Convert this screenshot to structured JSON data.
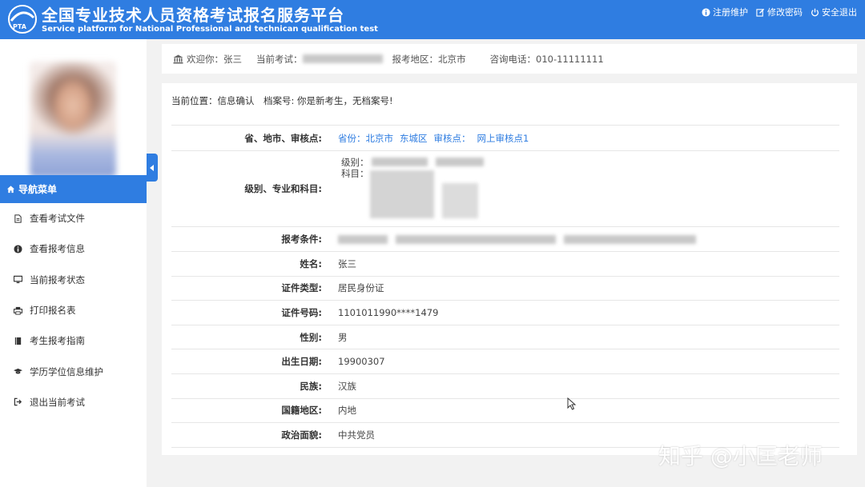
{
  "header": {
    "title_cn": "全国专业技术人员资格考试报名服务平台",
    "title_en": "Service platform for National Professional and technican qualification test",
    "links": [
      "注册维护",
      "修改密码",
      "安全退出"
    ],
    "brand_color": "#2f7de1"
  },
  "sidebar": {
    "nav_title": "导航菜单",
    "items": [
      {
        "label": "查看考试文件",
        "icon": "file-icon"
      },
      {
        "label": "查看报考信息",
        "icon": "info-circle-icon"
      },
      {
        "label": "当前报考状态",
        "icon": "monitor-icon"
      },
      {
        "label": "打印报名表",
        "icon": "printer-icon"
      },
      {
        "label": "考生报考指南",
        "icon": "book-icon"
      },
      {
        "label": "学历学位信息维护",
        "icon": "graduation-cap-icon"
      },
      {
        "label": "退出当前考试",
        "icon": "sign-out-icon"
      }
    ]
  },
  "infobar": {
    "welcome": "欢迎你：张三",
    "current_exam_label": "当前考试：",
    "region": "报考地区：北京市",
    "phone": "咨询电话：010-11111111"
  },
  "breadcrumb": "当前位置：信息确认　档案号: 你是新考生，无档案号!",
  "form": {
    "province_label": "省、地市、审核点:",
    "province_parts": [
      "省份：北京市",
      "东城区",
      "审核点：",
      "网上审核点1"
    ],
    "level_label": "级别、专业和科目:",
    "level_sub": "级别：",
    "subject_sub": "科目：",
    "condition_label": "报考条件:",
    "rows": [
      {
        "label": "姓名:",
        "value": "张三"
      },
      {
        "label": "证件类型:",
        "value": "居民身份证"
      },
      {
        "label": "证件号码:",
        "value": "1101011990****1479"
      },
      {
        "label": "性别:",
        "value": "男"
      },
      {
        "label": "出生日期:",
        "value": "19900307"
      },
      {
        "label": "民族:",
        "value": "汉族"
      },
      {
        "label": "国籍地区:",
        "value": "内地"
      },
      {
        "label": "政治面貌:",
        "value": "中共党员"
      }
    ]
  },
  "watermark": "知乎 @小匡老师"
}
